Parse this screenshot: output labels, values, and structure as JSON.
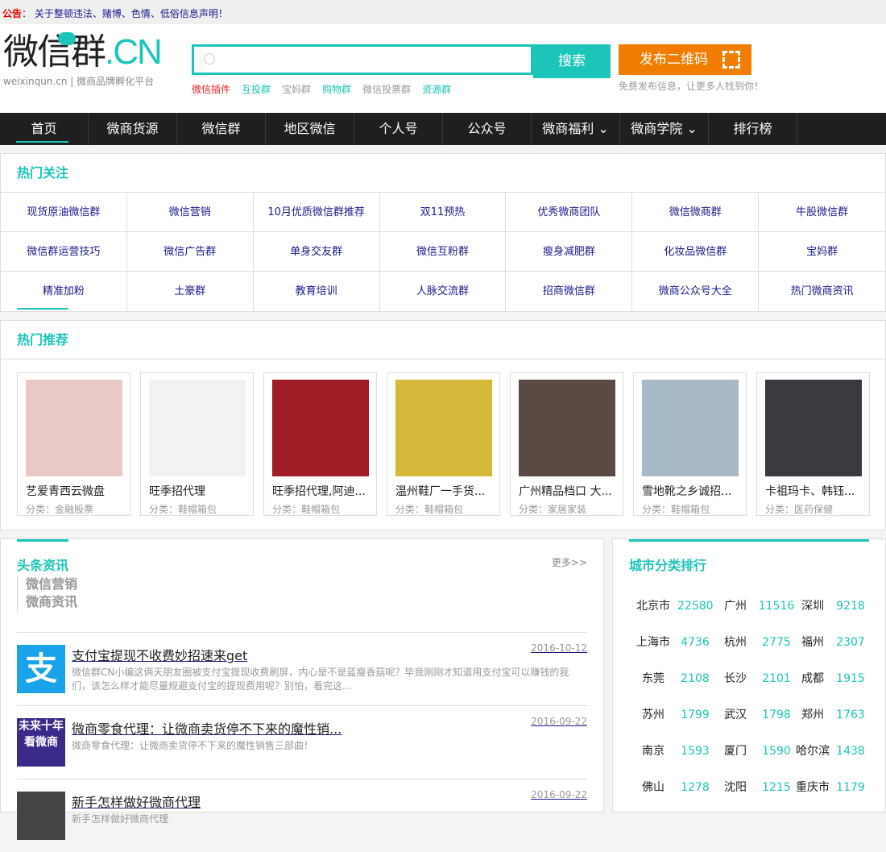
{
  "notice": {
    "label": "公告",
    "sep": "：",
    "text": "关于整顿违法、赌博、色情、低俗信息声明！"
  },
  "logo": {
    "main": "微信群",
    "cn": ".CN",
    "sub": "weixinqun.cn | 微商品牌孵化平台"
  },
  "search": {
    "placeholder": "",
    "button": "搜索",
    "hot": [
      {
        "label": "微信插件",
        "color": "#e8232b"
      },
      {
        "label": "互投群",
        "color": "#1cc5b9"
      },
      {
        "label": "宝妈群",
        "color": "#999999"
      },
      {
        "label": "购物群",
        "color": "#1cc5b9"
      },
      {
        "label": "微信投票群",
        "color": "#999999"
      },
      {
        "label": "资源群",
        "color": "#1cc5b9"
      }
    ]
  },
  "publish": {
    "button": "发布二维码",
    "tip": "免费发布信息，让更多人找到你！"
  },
  "nav": [
    "首页",
    "微商货源",
    "微信群",
    "地区微信",
    "个人号",
    "公众号",
    "微商福利 ⌄",
    "微商学院 ⌄",
    "排行榜"
  ],
  "hot_follow": {
    "title": "热门关注",
    "items": [
      "现货原油微信群",
      "微信营销",
      "10月优质微信群推荐",
      "双11预热",
      "优秀微商团队",
      "微信微商群",
      "牛股微信群",
      "微信群运营技巧",
      "微信广告群",
      "单身交友群",
      "微信互粉群",
      "瘦身减肥群",
      "化妆品微信群",
      "宝妈群",
      "精准加粉",
      "土豪群",
      "教育培训",
      "人脉交流群",
      "招商微信群",
      "微商公众号大全",
      "热门微商资讯"
    ]
  },
  "recommend": {
    "title": "热门推荐",
    "cards": [
      {
        "title": "艺爱青西云微盘",
        "category": "分类：金融股票",
        "color": "#e8c9c5"
      },
      {
        "title": "旺季招代理",
        "category": "分类：鞋帽箱包",
        "color": "#f2f2f2"
      },
      {
        "title": "旺季招代理,阿迪...",
        "category": "分类：鞋帽箱包",
        "color": "#a01d28"
      },
      {
        "title": "温州鞋厂一手货...",
        "category": "分类：鞋帽箱包",
        "color": "#d6b93a"
      },
      {
        "title": "广州精品档口 大...",
        "category": "分类：家居家装",
        "color": "#5a4a44"
      },
      {
        "title": "雪地靴之乡诚招...",
        "category": "分类：鞋帽箱包",
        "color": "#a7b9c6"
      },
      {
        "title": "卡祖玛卡、韩钰...",
        "category": "分类：医药保健",
        "color": "#3a3a40"
      }
    ]
  },
  "news": {
    "title": "头条资讯",
    "more": "更多>>",
    "tabs": [
      "微信营销",
      "微商资讯"
    ],
    "items": [
      {
        "title": "支付宝提现不收费妙招速来get",
        "desc": "微信群CN小编这俩天朋友圈被支付宝提现收费刷屏，内心是不是蓝瘦香菇呢？毕竟刚刚才知道用支付宝可以赚钱的我们，该怎么样才能尽量规避支付宝的提现费用呢？别怕，看完这...",
        "date": "2016-10-12",
        "thumb": "支",
        "color": "#1aa3e8"
      },
      {
        "title": "微商零食代理：让微商卖货停不下来的魔性销...",
        "desc": "微商零食代理：让微商卖货停不下来的魔性销售三部曲！",
        "date": "2016-09-22",
        "thumb": "未来十年看微商",
        "color": "#3b2a8a"
      },
      {
        "title": "新手怎样做好微商代理",
        "desc": "新手怎样做好微商代理",
        "date": "2016-09-22",
        "thumb": "",
        "color": "#444444"
      }
    ]
  },
  "city": {
    "title": "城市分类排行",
    "rows": [
      [
        "北京市",
        "22580",
        "广州",
        "11516",
        "深圳",
        "9218"
      ],
      [
        "上海市",
        "4736",
        "杭州",
        "2775",
        "福州",
        "2307"
      ],
      [
        "东莞",
        "2108",
        "长沙",
        "2101",
        "成都",
        "1915"
      ],
      [
        "苏州",
        "1799",
        "武汉",
        "1798",
        "郑州",
        "1763"
      ],
      [
        "南京",
        "1593",
        "厦门",
        "1590",
        "哈尔滨",
        "1438"
      ],
      [
        "佛山",
        "1278",
        "沈阳",
        "1215",
        "重庆市",
        "1179"
      ]
    ]
  }
}
